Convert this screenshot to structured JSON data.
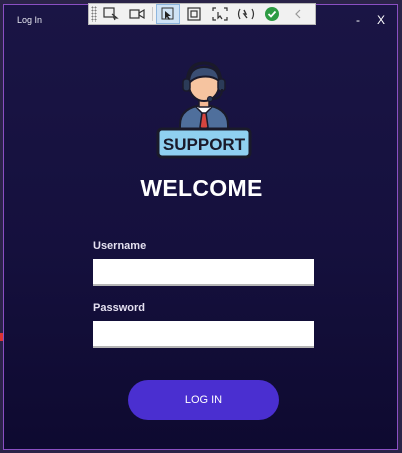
{
  "window": {
    "title": "Log In",
    "minimize_label": "-",
    "close_label": "X"
  },
  "devtools_toolbar": {
    "tools": [
      "select-element",
      "record",
      "pointer",
      "box-select",
      "screen-capture",
      "hot-reload",
      "checked",
      "collapse"
    ]
  },
  "logo": {
    "badge_text": "SUPPORT"
  },
  "heading": "WELCOME",
  "form": {
    "username_label": "Username",
    "username_value": "",
    "password_label": "Password",
    "password_value": "",
    "submit_label": "LOG IN"
  },
  "colors": {
    "background_top": "#1a1545",
    "background_bottom": "#0e0a30",
    "border": "#8a4fc3",
    "button": "#4a2fd0",
    "badge": "#8fd0f0"
  }
}
